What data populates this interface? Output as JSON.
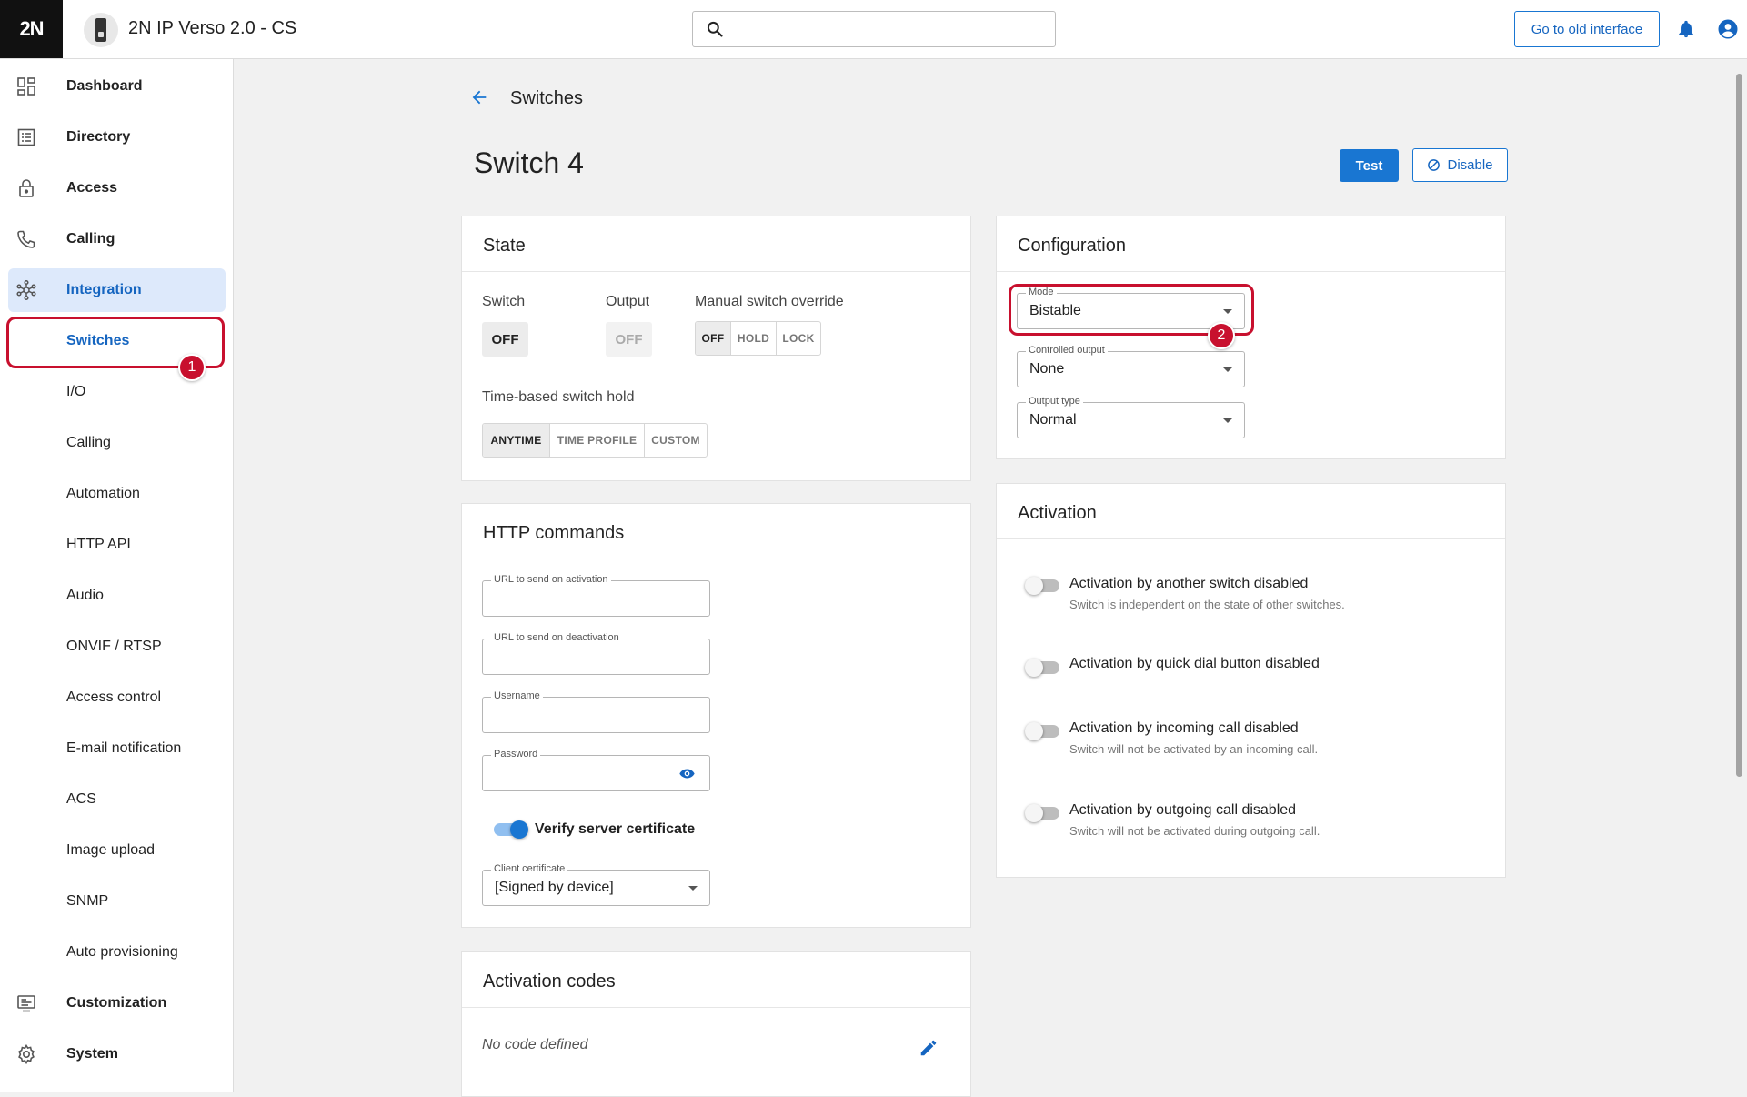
{
  "header": {
    "logo": "2N",
    "device_title": "2N IP Verso 2.0 - CS",
    "search_placeholder": "",
    "old_interface_label": "Go to old interface",
    "icons": [
      "search-icon",
      "bell-icon",
      "user-icon"
    ]
  },
  "sidebar": {
    "main_items": [
      {
        "label": "Dashboard",
        "icon": "dashboard-icon"
      },
      {
        "label": "Directory",
        "icon": "directory-icon"
      },
      {
        "label": "Access",
        "icon": "lock-icon"
      },
      {
        "label": "Calling",
        "icon": "phone-icon"
      },
      {
        "label": "Integration",
        "icon": "integration-icon"
      },
      {
        "label": "Customization",
        "icon": "customization-icon"
      },
      {
        "label": "System",
        "icon": "gear-icon"
      }
    ],
    "sub_items": [
      "Switches",
      "I/O",
      "Calling",
      "Automation",
      "HTTP API",
      "Audio",
      "ONVIF / RTSP",
      "Access control",
      "E-mail notification",
      "ACS",
      "Image upload",
      "SNMP",
      "Auto provisioning"
    ],
    "callout_number": "1"
  },
  "page": {
    "breadcrumb": "Switches",
    "title": "Switch 4",
    "test_label": "Test",
    "disable_label": "Disable"
  },
  "state": {
    "title": "State",
    "switch_label": "Switch",
    "switch_value": "OFF",
    "output_label": "Output",
    "output_value": "OFF",
    "override_label": "Manual switch override",
    "override_options": [
      "OFF",
      "HOLD",
      "LOCK"
    ],
    "override_selected": "OFF",
    "hold_label": "Time-based switch hold",
    "hold_options": [
      "ANYTIME",
      "TIME PROFILE",
      "CUSTOM"
    ],
    "hold_selected": "ANYTIME"
  },
  "http": {
    "title": "HTTP commands",
    "url_activation_label": "URL to send on activation",
    "url_activation_value": "",
    "url_deactivation_label": "URL to send on deactivation",
    "url_deactivation_value": "",
    "username_label": "Username",
    "username_value": "",
    "password_label": "Password",
    "password_value": "",
    "verify_label": "Verify server certificate",
    "verify_on": true,
    "client_cert_label": "Client certificate",
    "client_cert_value": "[Signed by device]"
  },
  "codes": {
    "title": "Activation codes",
    "empty": "No code defined"
  },
  "configuration": {
    "title": "Configuration",
    "mode_label": "Mode",
    "mode_value": "Bistable",
    "controlled_output_label": "Controlled output",
    "controlled_output_value": "None",
    "output_type_label": "Output type",
    "output_type_value": "Normal",
    "callout_number": "2"
  },
  "activation": {
    "title": "Activation",
    "items": [
      {
        "title": "Activation by another switch disabled",
        "subtitle": "Switch is independent on the state of other switches.",
        "enabled": false
      },
      {
        "title": "Activation by quick dial button disabled",
        "subtitle": "",
        "enabled": false
      },
      {
        "title": "Activation by incoming call disabled",
        "subtitle": "Switch will not be activated by an incoming call.",
        "enabled": false
      },
      {
        "title": "Activation by outgoing call disabled",
        "subtitle": "Switch will not be activated during outgoing call.",
        "enabled": false
      }
    ]
  },
  "colors": {
    "accent": "#1976d2",
    "callout": "#c8102e",
    "active_nav_bg": "#dde9fb"
  }
}
